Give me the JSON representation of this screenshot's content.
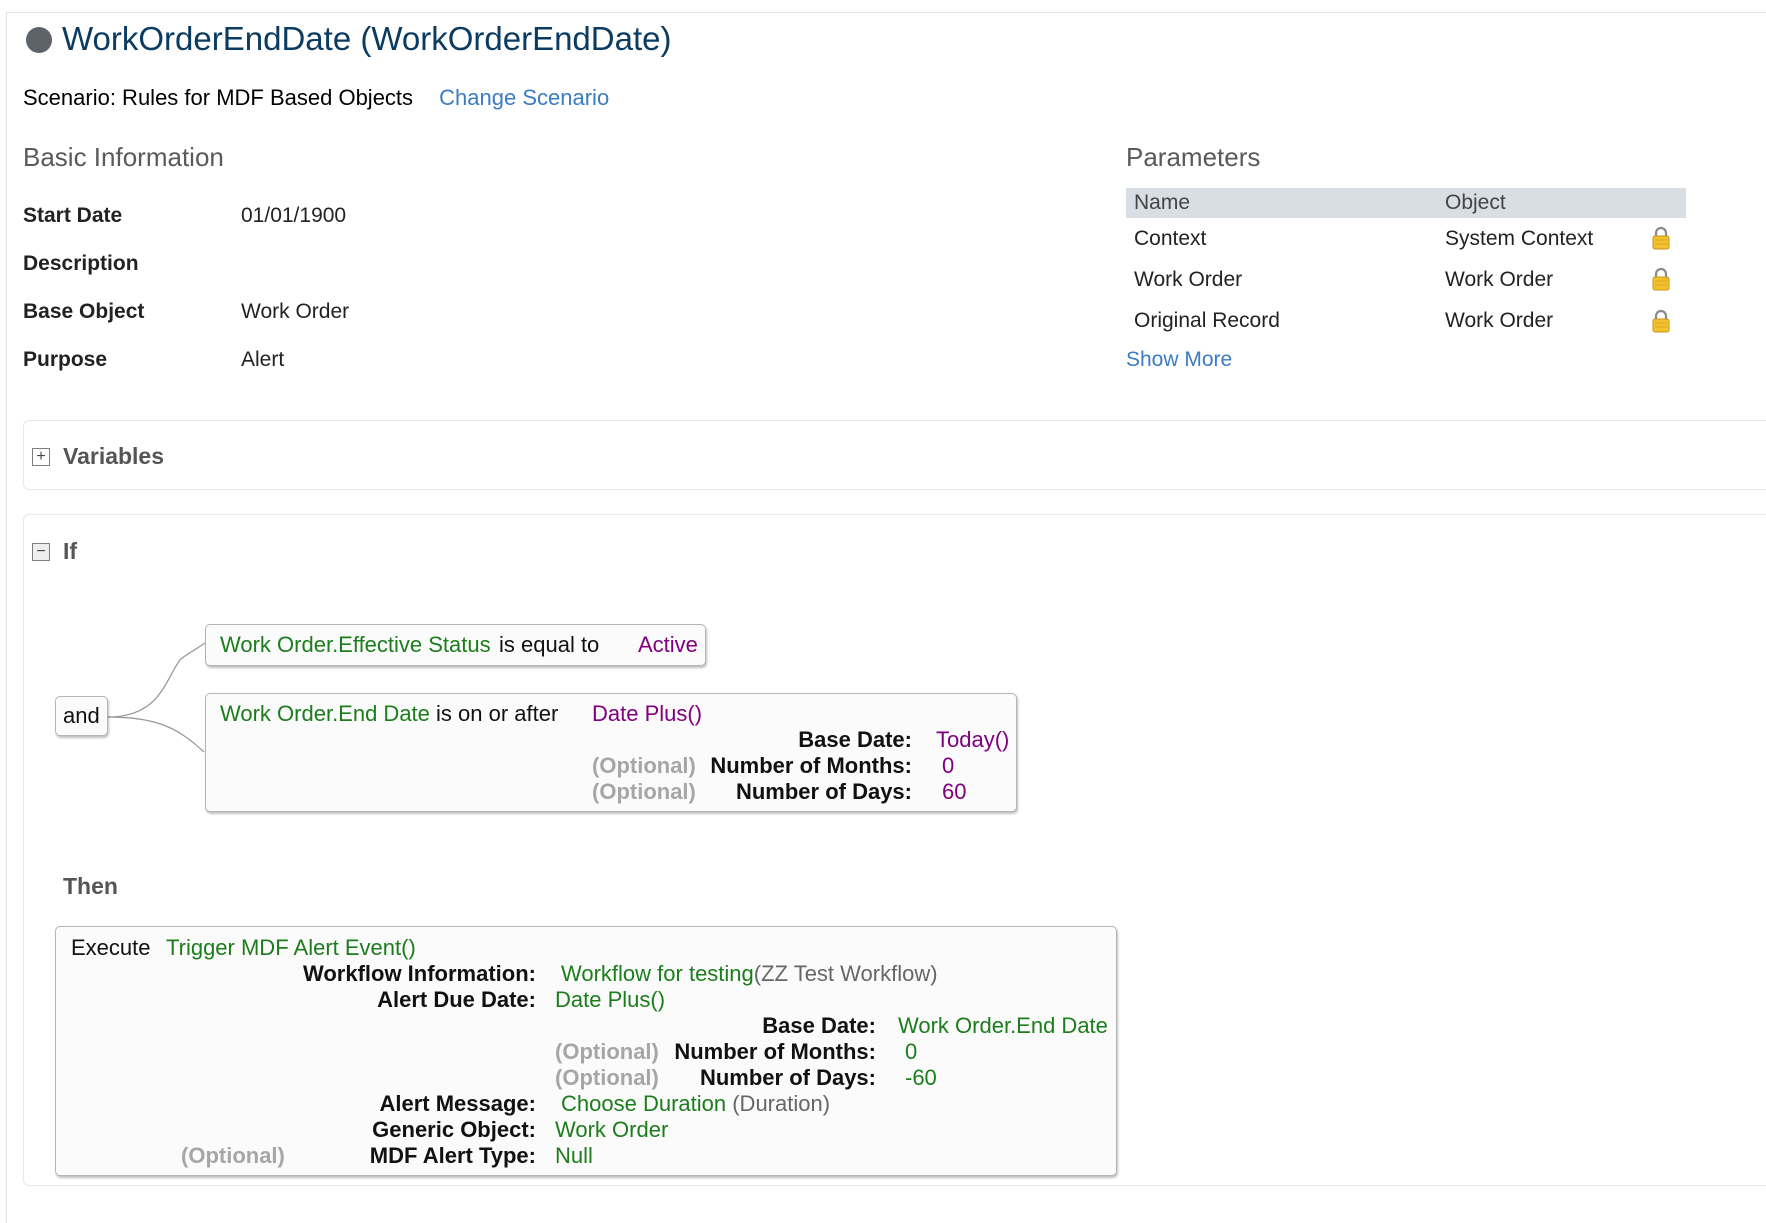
{
  "header": {
    "title": "WorkOrderEndDate (WorkOrderEndDate)",
    "scenario_text": "Scenario: Rules for MDF Based Objects",
    "change_scenario_label": "Change Scenario"
  },
  "basic_info": {
    "heading": "Basic Information",
    "fields": [
      {
        "label": "Start Date",
        "value": "01/01/1900"
      },
      {
        "label": "Description",
        "value": ""
      },
      {
        "label": "Base Object",
        "value": "Work Order"
      },
      {
        "label": "Purpose",
        "value": "Alert"
      }
    ]
  },
  "parameters": {
    "heading": "Parameters",
    "columns": [
      "Name",
      "Object"
    ],
    "rows": [
      {
        "name": "Context",
        "object": "System Context"
      },
      {
        "name": "Work Order",
        "object": "Work Order"
      },
      {
        "name": "Original Record",
        "object": "Work Order"
      }
    ],
    "show_more_label": "Show More"
  },
  "variables": {
    "title": "Variables",
    "toggle": "+"
  },
  "if_block": {
    "title": "If",
    "toggle": "−",
    "operator": "and",
    "cond1": {
      "field": "Work Order.Effective Status",
      "op": "is equal to",
      "value": "Active"
    },
    "cond2": {
      "field": "Work Order.End Date",
      "op": "is on or after",
      "func": "Date Plus()",
      "base_date_label": "Base Date:",
      "base_date_value": "Today()",
      "optional_label": "(Optional)",
      "months_label": "Number of Months:",
      "months_value": "0",
      "days_label": "Number of Days:",
      "days_value": "60"
    }
  },
  "then_block": {
    "title": "Then",
    "execute_label": "Execute",
    "execute_func": "Trigger MDF Alert Event()",
    "workflow_label": "Workflow Information:",
    "workflow_value": "Workflow for testing",
    "workflow_extra": "(ZZ Test Workflow)",
    "due_label": "Alert Due Date:",
    "due_func": "Date Plus()",
    "base_date_label": "Base Date:",
    "base_date_value": "Work Order.End Date",
    "optional_label": "(Optional)",
    "months_label": "Number of Months:",
    "months_value": "0",
    "days_label": "Number of Days:",
    "days_value": "-60",
    "message_label": "Alert Message:",
    "message_value": "Choose Duration",
    "message_extra": "(Duration)",
    "generic_label": "Generic Object:",
    "generic_value": "Work Order",
    "type_label": "MDF Alert Type:",
    "type_value": "Null"
  },
  "icons": {
    "lock": "lock-icon",
    "status": "status-dot-icon"
  },
  "colors": {
    "title": "#0b3b60",
    "link": "#3a7cc4",
    "field": "#1b7d1b",
    "value": "#800080",
    "optional": "#a6a6a6"
  }
}
